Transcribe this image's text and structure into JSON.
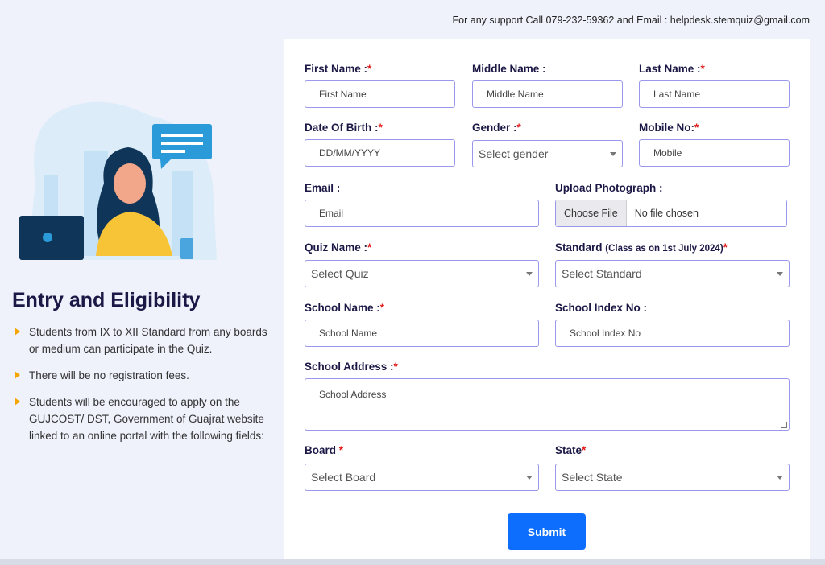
{
  "support": "For any support Call 079-232-59362 and Email : helpdesk.stemquiz@gmail.com",
  "left": {
    "title": "Entry and Eligibility",
    "items": [
      "Students from IX to XII Standard from any boards or medium can participate in the Quiz.",
      "There will be no registration fees.",
      "Students will be encouraged to apply on the GUJCOST/ DST, Government of Guajrat website linked to an online portal with the following fields:"
    ]
  },
  "form": {
    "first_name": {
      "label": "First Name :",
      "placeholder": "First Name"
    },
    "middle_name": {
      "label": "Middle Name :",
      "placeholder": "Middle Name"
    },
    "last_name": {
      "label": "Last Name :",
      "placeholder": "Last Name"
    },
    "dob": {
      "label": "Date Of Birth :",
      "placeholder": "DD/MM/YYYY"
    },
    "gender": {
      "label": "Gender :",
      "value": "Select gender"
    },
    "mobile": {
      "label": "Mobile No:",
      "placeholder": "Mobile"
    },
    "email": {
      "label": "Email :",
      "placeholder": "Email"
    },
    "photo": {
      "label": "Upload Photograph :",
      "button": "Choose File",
      "status": "No file chosen"
    },
    "quiz": {
      "label": "Quiz Name :",
      "value": "Select Quiz"
    },
    "standard": {
      "label": "Standard",
      "note": "(Class as on 1st July 2024)",
      "value": "Select Standard"
    },
    "school_name": {
      "label": "School Name :",
      "placeholder": "School Name"
    },
    "school_index": {
      "label": "School Index No :",
      "placeholder": "School Index No"
    },
    "school_address": {
      "label": "School Address :",
      "placeholder": "School Address"
    },
    "board": {
      "label": "Board",
      "value": "Select Board"
    },
    "state": {
      "label": "State",
      "value": "Select State"
    },
    "required_mark": "*",
    "submit": "Submit"
  },
  "colors": {
    "accent": "#0d6efd",
    "input_border": "#9a98ec",
    "required": "#e01b1b",
    "bullet": "#f5a500"
  }
}
